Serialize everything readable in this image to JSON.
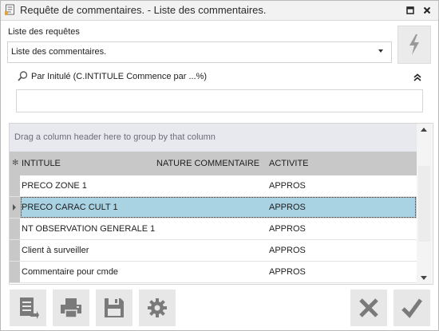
{
  "window": {
    "title": "Requête de commentaires. - Liste des commentaires."
  },
  "requests": {
    "label": "Liste des requêtes",
    "selected": "Liste des commentaires."
  },
  "search": {
    "label": "Par Initulé (C.INTITULE Commence par ...%)",
    "value": ""
  },
  "grid": {
    "group_hint": "Drag a column header here to group by that column",
    "columns": [
      "INTITULE",
      "NATURE COMMENTAIRE",
      "ACTIVITE"
    ],
    "rows": [
      {
        "intitule": "PRECO ZONE 1",
        "nature": "",
        "activite": "APPROS"
      },
      {
        "intitule": "PRECO CARAC CULT 1",
        "nature": "",
        "activite": "APPROS"
      },
      {
        "intitule": "NT OBSERVATION GENERALE 1",
        "nature": "",
        "activite": "APPROS"
      },
      {
        "intitule": "Client à surveiller",
        "nature": "",
        "activite": "APPROS"
      },
      {
        "intitule": "Commentaire pour cmde",
        "nature": "",
        "activite": "APPROS"
      }
    ],
    "selected_row": 1
  },
  "toolbar": {
    "left_icons": [
      "export-list-icon",
      "printer-icon",
      "save-icon",
      "gear-icon"
    ],
    "right_icons": [
      "cancel-x-icon",
      "validate-check-icon"
    ]
  },
  "colors": {
    "selected_row": "#a9d2e3",
    "header": "#c8c8c8",
    "group_panel": "#e8e9ee",
    "toolbar_button": "#e7e7e7"
  }
}
